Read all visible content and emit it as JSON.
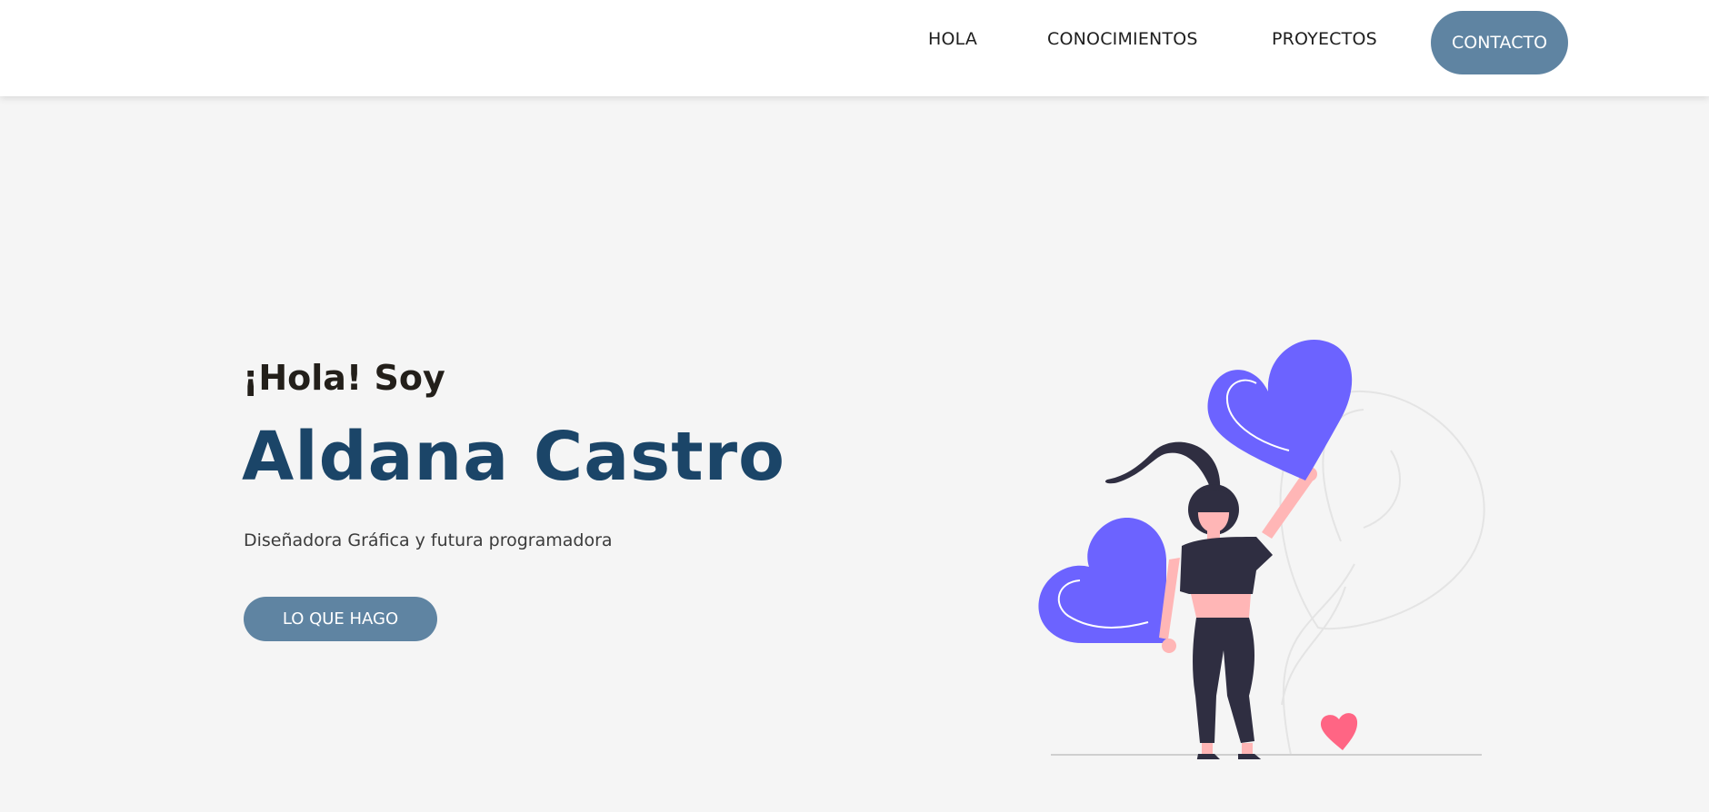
{
  "nav": {
    "items": [
      {
        "label": "HOLA"
      },
      {
        "label": "CONOCIMIENTOS"
      },
      {
        "label": "PROYECTOS"
      }
    ],
    "contact_label": "CONTACTO"
  },
  "hero": {
    "greeting": "¡Hola! Soy",
    "name": "Aldana Castro",
    "subtitle": "Diseñadora Gráfica y futura programadora",
    "cta_label": "LO QUE HAGO"
  },
  "colors": {
    "accent": "#5f84a2",
    "name": "#1b4568",
    "heart": "#6c63ff",
    "heart_small": "#ff6584",
    "background": "#f5f5f5"
  },
  "icons": {
    "illustration": "woman-holding-hearts-illustration"
  }
}
